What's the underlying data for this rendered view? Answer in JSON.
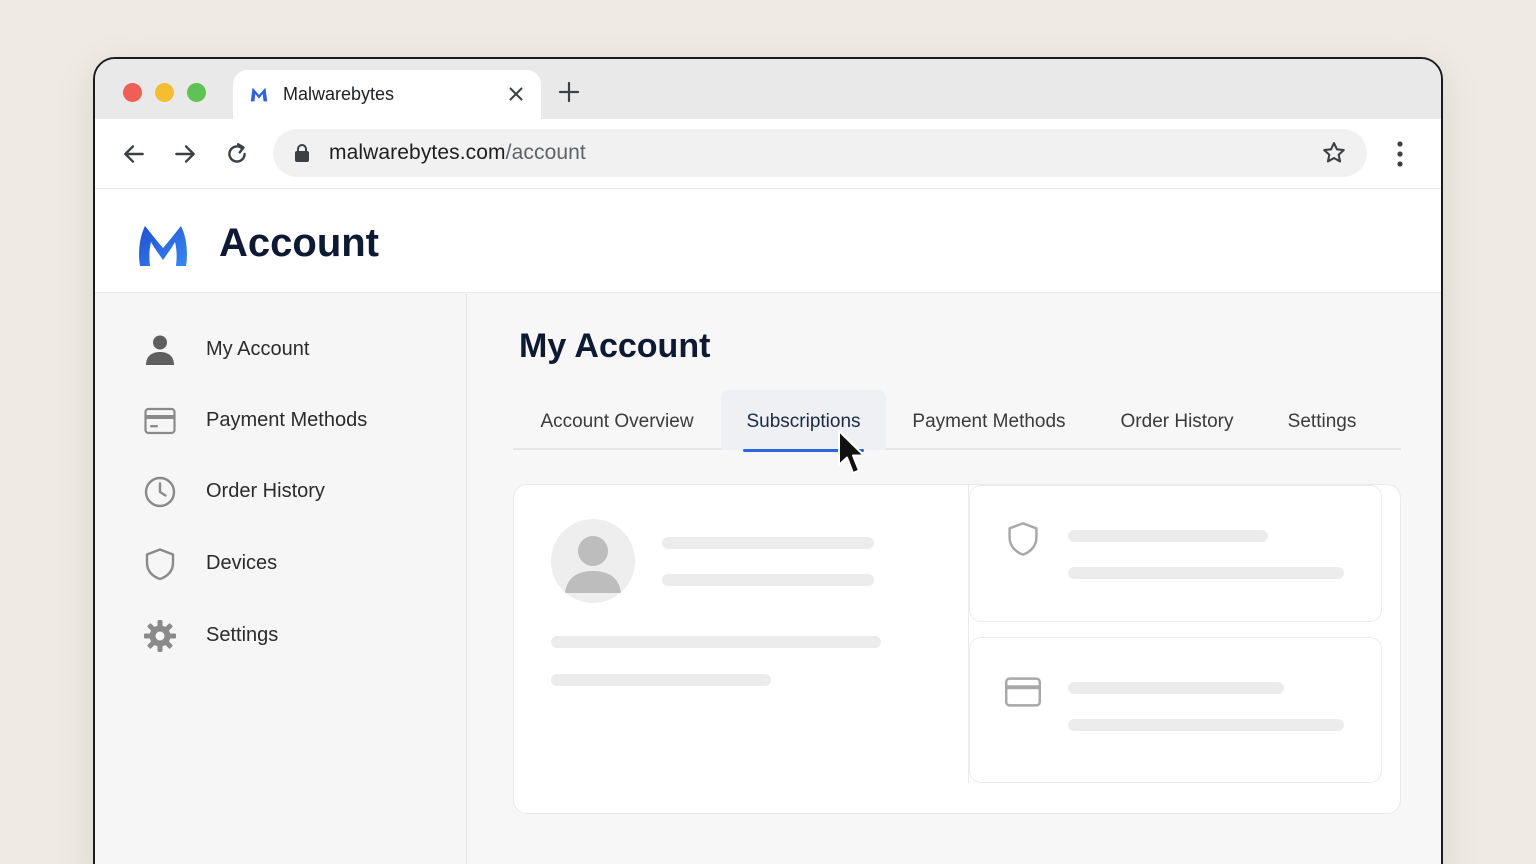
{
  "browser": {
    "tab_title": "Malwarebytes",
    "url_host": "malwarebytes.com",
    "url_path": "/account"
  },
  "header": {
    "title": "Account"
  },
  "sidebar": {
    "items": [
      {
        "label": "My Account",
        "icon": "person-icon"
      },
      {
        "label": "Payment Methods",
        "icon": "credit-card-icon"
      },
      {
        "label": "Order History",
        "icon": "clock-icon"
      },
      {
        "label": "Devices",
        "icon": "shield-icon"
      },
      {
        "label": "Settings",
        "icon": "gear-icon"
      }
    ]
  },
  "main": {
    "title": "My Account",
    "tabs": [
      {
        "label": "Account Overview",
        "active": false
      },
      {
        "label": "Subscriptions",
        "active": true
      },
      {
        "label": "Payment Methods",
        "active": false
      },
      {
        "label": "Order History",
        "active": false
      },
      {
        "label": "Settings",
        "active": false
      }
    ]
  },
  "colors": {
    "brand_blue": "#2f63d8",
    "heading": "#0e1a33",
    "background": "#efebe4"
  }
}
